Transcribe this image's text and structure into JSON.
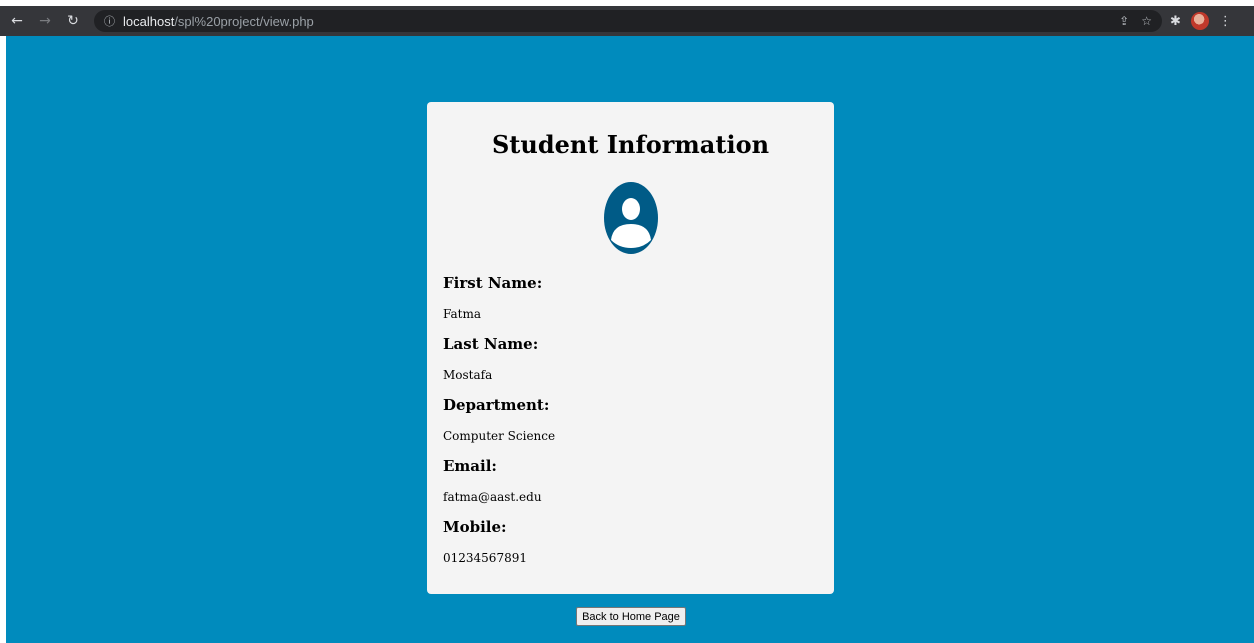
{
  "browser": {
    "url_host": "localhost",
    "url_path": "/spl%20project/view.php",
    "icons": [
      "back-arrow-icon",
      "forward-arrow-icon",
      "reload-icon",
      "info-icon",
      "share-icon",
      "star-icon",
      "extensions-icon",
      "profile-avatar",
      "menu-icon"
    ]
  },
  "page": {
    "background_color": "#008bbd",
    "card_color": "#f4f4f4",
    "accent_color": "#005b87"
  },
  "card": {
    "title": "Student Information",
    "fields": [
      {
        "label": "First Name:",
        "value": "Fatma"
      },
      {
        "label": "Last Name:",
        "value": "Mostafa"
      },
      {
        "label": "Department:",
        "value": "Computer Science"
      },
      {
        "label": "Email:",
        "value": "fatma@aast.edu"
      },
      {
        "label": "Mobile:",
        "value": "01234567891"
      }
    ]
  },
  "actions": {
    "back_label": "Back to Home Page"
  }
}
